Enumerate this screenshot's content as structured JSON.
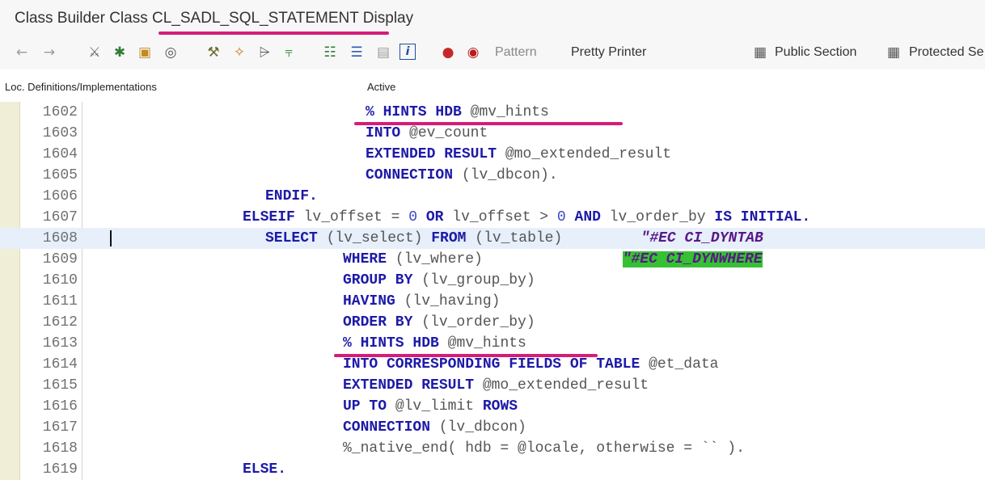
{
  "window": {
    "title": "Class Builder Class CL_SADL_SQL_STATEMENT Display"
  },
  "toolbar": {
    "icons": [
      {
        "name": "back-arrow-icon",
        "glyph": "←",
        "color": "#9a9a9a"
      },
      {
        "name": "forward-arrow-icon",
        "glyph": "→",
        "color": "#9a9a9a"
      },
      {
        "name": "display-change-icon",
        "glyph": "⚔",
        "color": "#666666"
      },
      {
        "name": "activate-icon",
        "glyph": "✱",
        "color": "#2e7d32"
      },
      {
        "name": "check-icon",
        "glyph": "▣",
        "color": "#c48a1c"
      },
      {
        "name": "where-used-icon",
        "glyph": "◎",
        "color": "#555555"
      },
      {
        "name": "test-icon",
        "glyph": "⚒",
        "color": "#6d6d2e"
      },
      {
        "name": "magic-wand-icon",
        "glyph": "✧",
        "color": "#c77a1e"
      },
      {
        "name": "split-icon",
        "glyph": "⩥",
        "color": "#555555"
      },
      {
        "name": "tree-icon",
        "glyph": "⫧",
        "color": "#3e8e3e"
      },
      {
        "name": "hierarchy-icon",
        "glyph": "☷",
        "color": "#2e7d32"
      },
      {
        "name": "list-icon",
        "glyph": "☰",
        "color": "#2a5db0"
      },
      {
        "name": "document-icon",
        "glyph": "▤",
        "color": "#9a9a9a"
      },
      {
        "name": "info-icon",
        "glyph": "i",
        "color": "#1d4fa0"
      },
      {
        "name": "breakpoint-icon",
        "glyph": "●",
        "color": "#c62828"
      },
      {
        "name": "external-breakpoint-icon",
        "glyph": "◉",
        "color": "#b71c1c"
      },
      {
        "name": "public-section-icon",
        "glyph": "▦",
        "color": "#555555"
      },
      {
        "name": "protected-section-icon",
        "glyph": "▦",
        "color": "#555555"
      }
    ],
    "pattern_label": "Pattern",
    "pretty_printer_label": "Pretty Printer",
    "public_section_label": "Public Section",
    "protected_section_label": "Protected Se"
  },
  "subheader": {
    "loc_label": "Loc. Definitions/Implementations",
    "status": "Active"
  },
  "code_lines": [
    {
      "num": "1602",
      "tokens": [
        [
          "% HINTS HDB",
          "kw"
        ],
        [
          " ",
          ""
        ],
        [
          "@mv_hints",
          "id"
        ]
      ]
    },
    {
      "num": "1603",
      "tokens": [
        [
          "INTO",
          "kw"
        ],
        [
          " ",
          ""
        ],
        [
          "@ev_count",
          "id"
        ]
      ]
    },
    {
      "num": "1604",
      "tokens": [
        [
          "EXTENDED RESULT",
          "kw"
        ],
        [
          " ",
          ""
        ],
        [
          "@mo_extended_result",
          "id"
        ]
      ]
    },
    {
      "num": "1605",
      "tokens": [
        [
          "CONNECTION",
          "kw"
        ],
        [
          " ",
          ""
        ],
        [
          "(lv_dbcon).",
          "id"
        ]
      ]
    },
    {
      "num": "1606",
      "tokens": [
        [
          "ENDIF.",
          "kw"
        ]
      ]
    },
    {
      "num": "1607",
      "tokens": [
        [
          "ELSEIF",
          "kw"
        ],
        [
          " lv_offset = ",
          "id"
        ],
        [
          "0",
          "lit"
        ],
        [
          " ",
          ""
        ],
        [
          "OR",
          "kw"
        ],
        [
          " lv_offset > ",
          "id"
        ],
        [
          "0",
          "lit"
        ],
        [
          " ",
          ""
        ],
        [
          "AND",
          "kw"
        ],
        [
          " lv_order_by ",
          "id"
        ],
        [
          "IS INITIAL.",
          "kw"
        ]
      ]
    },
    {
      "num": "1608",
      "tokens": [
        [
          "SELECT",
          "kw"
        ],
        [
          " (lv_select) ",
          "id"
        ],
        [
          "FROM",
          "kw"
        ],
        [
          " (lv_table)         ",
          "id"
        ],
        [
          "\"#EC CI_DYNTAB",
          "cmt"
        ]
      ]
    },
    {
      "num": "1609",
      "tokens": [
        [
          "WHERE",
          "kw"
        ],
        [
          " (lv_where)                ",
          "id"
        ],
        [
          "\"#EC CI_DYNWHERE",
          "cmt-hl"
        ]
      ]
    },
    {
      "num": "1610",
      "tokens": [
        [
          "GROUP BY",
          "kw"
        ],
        [
          " (lv_group_by)",
          "id"
        ]
      ]
    },
    {
      "num": "1611",
      "tokens": [
        [
          "HAVING",
          "kw"
        ],
        [
          " (lv_having)",
          "id"
        ]
      ]
    },
    {
      "num": "1612",
      "tokens": [
        [
          "ORDER BY",
          "kw"
        ],
        [
          " (lv_order_by)",
          "id"
        ]
      ]
    },
    {
      "num": "1613",
      "tokens": [
        [
          "% HINTS HDB",
          "kw"
        ],
        [
          " ",
          ""
        ],
        [
          "@mv_hints",
          "id"
        ]
      ]
    },
    {
      "num": "1614",
      "tokens": [
        [
          "INTO CORRESPONDING FIELDS OF TABLE",
          "kw"
        ],
        [
          " @et_data",
          "id"
        ]
      ]
    },
    {
      "num": "1615",
      "tokens": [
        [
          "EXTENDED RESULT",
          "kw"
        ],
        [
          " @mo_extended_result",
          "id"
        ]
      ]
    },
    {
      "num": "1616",
      "tokens": [
        [
          "UP TO",
          "kw"
        ],
        [
          " @lv_limit ",
          "id"
        ],
        [
          "ROWS",
          "kw"
        ]
      ]
    },
    {
      "num": "1617",
      "tokens": [
        [
          "CONNECTION",
          "kw"
        ],
        [
          " (lv_dbcon)",
          "id"
        ]
      ]
    },
    {
      "num": "1618",
      "tokens": [
        [
          "%_native_end( hdb = @locale, otherwise = `` ).",
          "id"
        ]
      ]
    },
    {
      "num": "1619",
      "tokens": [
        [
          "ELSE.",
          "kw"
        ]
      ]
    }
  ],
  "current_line": "1608"
}
